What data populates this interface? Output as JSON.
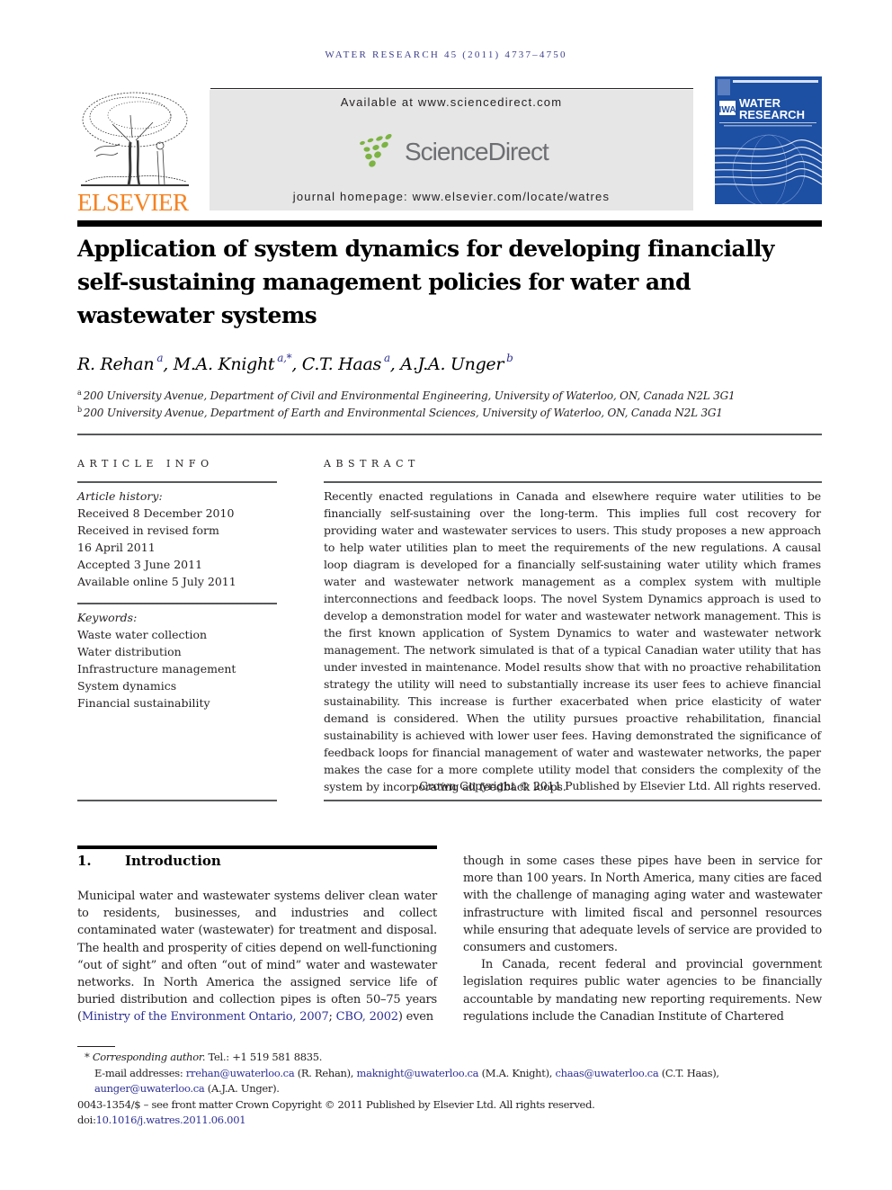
{
  "running_head": "WATER RESEARCH 45 (2011) 4737–4750",
  "masthead": {
    "publisher": "ELSEVIER",
    "available_at": "Available at www.sciencedirect.com",
    "sciencedirect_name": "ScienceDirect",
    "journal_homepage": "journal homepage: www.elsevier.com/locate/watres",
    "cover": {
      "badge": "IWA",
      "journal_line1": "WATER",
      "journal_line2": "RESEARCH",
      "background_color": "#1d4fa3"
    },
    "brand_colors": {
      "elsevier_orange": "#f58220",
      "sciencedirect_green": "#7cb342",
      "link_blue": "#2e3092"
    }
  },
  "article": {
    "title": "Application of system dynamics for developing financially self-sustaining management policies for water and wastewater systems",
    "authors": [
      {
        "name": "R. Rehan",
        "sup": "a"
      },
      {
        "name": "M.A. Knight",
        "sup": "a,*"
      },
      {
        "name": "C.T. Haas",
        "sup": "a"
      },
      {
        "name": "A.J.A. Unger",
        "sup": "b"
      }
    ],
    "affiliations": [
      {
        "sup": "a",
        "text": "200 University Avenue, Department of Civil and Environmental Engineering, University of Waterloo, ON, Canada N2L 3G1"
      },
      {
        "sup": "b",
        "text": "200 University Avenue, Department of Earth and Environmental Sciences, University of Waterloo, ON, Canada N2L 3G1"
      }
    ]
  },
  "article_info": {
    "heading": "ARTICLE INFO",
    "history_label": "Article history:",
    "history": [
      "Received 8 December 2010",
      "Received in revised form",
      "16 April 2011",
      "Accepted 3 June 2011",
      "Available online 5 July 2011"
    ],
    "keywords_label": "Keywords:",
    "keywords": [
      "Waste water collection",
      "Water distribution",
      "Infrastructure management",
      "System dynamics",
      "Financial sustainability"
    ]
  },
  "abstract": {
    "heading": "ABSTRACT",
    "text": "Recently enacted regulations in Canada and elsewhere require water utilities to be financially self-sustaining over the long-term. This implies full cost recovery for providing water and wastewater services to users. This study proposes a new approach to help water utilities plan to meet the requirements of the new regulations. A causal loop diagram is developed for a financially self-sustaining water utility which frames water and wastewater network management as a complex system with multiple interconnections and feedback loops. The novel System Dynamics approach is used to develop a demonstration model for water and wastewater network management. This is the first known application of System Dynamics to water and wastewater network management. The network simulated is that of a typical Canadian water utility that has under invested in maintenance. Model results show that with no proactive rehabilitation strategy the utility will need to substantially increase its user fees to achieve financial sustainability. This increase is further exacerbated when price elasticity of water demand is considered. When the utility pursues proactive rehabilitation, financial sustainability is achieved with lower user fees. Having demonstrated the significance of feedback loops for financial management of water and wastewater networks, the paper makes the case for a more complete utility model that considers the complexity of the system by incorporating all feedback loops.",
    "copyright": "Crown Copyright © 2011 Published by Elsevier Ltd. All rights reserved."
  },
  "introduction": {
    "number": "1.",
    "heading": "Introduction",
    "p1_before_link": "Municipal water and wastewater systems deliver clean water to residents, businesses, and industries and collect contaminated water (wastewater) for treatment and disposal. The health and prosperity of cities depend on well-functioning “out of sight” and often “out of mind” water and wastewater networks. In North America the assigned service life of buried distribution and collection pipes is often 50–75 years (",
    "citation_1": "Ministry of the Environment Ontario, 2007",
    "citation_sep": "; ",
    "citation_2": "CBO, 2002",
    "p1_after_link": ") even",
    "p1_continued": "though in some cases these pipes have been in service for more than 100 years. In North America, many cities are faced with the challenge of managing aging water and wastewater infrastructure with limited fiscal and personnel resources while ensuring that adequate levels of service are provided to consumers and customers.",
    "p2": "In Canada, recent federal and provincial government legislation requires public water agencies to be financially accountable by mandating new reporting requirements. New regulations include the Canadian Institute of Chartered"
  },
  "footnotes": {
    "star": "*",
    "corresponding_label": "Corresponding author.",
    "tel": " Tel.: +1 519 581 8835.",
    "email_label": "E-mail addresses: ",
    "emails": [
      {
        "email": "rrehan@uwaterloo.ca",
        "who": " (R. Rehan), "
      },
      {
        "email": "maknight@uwaterloo.ca",
        "who": " (M.A. Knight), "
      },
      {
        "email": "chaas@uwaterloo.ca",
        "who": " (C.T. Haas), "
      },
      {
        "email": "aunger@uwaterloo.ca",
        "who": " (A.J.A. Unger)."
      }
    ],
    "front_matter": "0043-1354/$ – see front matter Crown Copyright © 2011 Published by Elsevier Ltd. All rights reserved.",
    "doi_label": "doi:",
    "doi": "10.1016/j.watres.2011.06.001"
  }
}
